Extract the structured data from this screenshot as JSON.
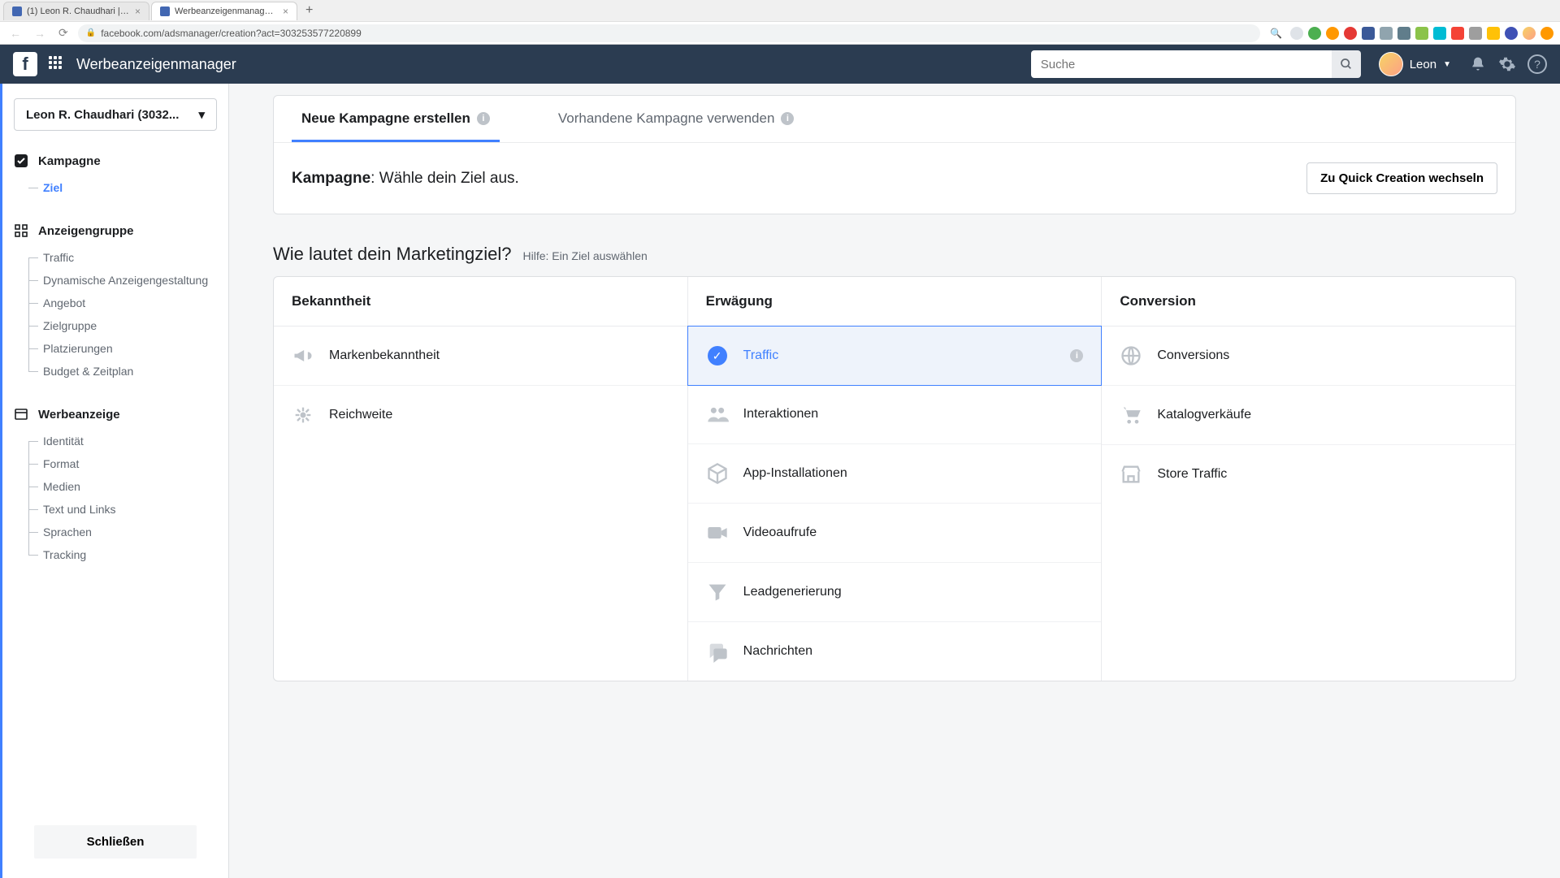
{
  "browser": {
    "tabs": [
      {
        "title": "(1) Leon R. Chaudhari | Faceb"
      },
      {
        "title": "Werbeanzeigenmanager - Cre"
      }
    ],
    "url": "facebook.com/adsmanager/creation?act=303253577220899"
  },
  "navbar": {
    "app_title": "Werbeanzeigenmanager",
    "search_placeholder": "Suche",
    "user_name": "Leon"
  },
  "sidebar": {
    "account_label": "Leon R. Chaudhari (3032...",
    "sections": {
      "campaign": {
        "title": "Kampagne",
        "items": [
          "Ziel"
        ]
      },
      "adgroup": {
        "title": "Anzeigengruppe",
        "items": [
          "Traffic",
          "Dynamische Anzeigengestaltung",
          "Angebot",
          "Zielgruppe",
          "Platzierungen",
          "Budget & Zeitplan"
        ]
      },
      "ad": {
        "title": "Werbeanzeige",
        "items": [
          "Identität",
          "Format",
          "Medien",
          "Text und Links",
          "Sprachen",
          "Tracking"
        ]
      }
    },
    "close_label": "Schließen"
  },
  "main": {
    "tab_new": "Neue Kampagne erstellen",
    "tab_existing": "Vorhandene Kampagne verwenden",
    "objective_strong": "Kampagne",
    "objective_rest": ": Wähle dein Ziel aus.",
    "quick_switch": "Zu Quick Creation wechseln",
    "question": "Wie lautet dein Marketingziel?",
    "help_link": "Hilfe: Ein Ziel auswählen",
    "columns": {
      "awareness": {
        "title": "Bekanntheit",
        "items": [
          "Markenbekanntheit",
          "Reichweite"
        ]
      },
      "consideration": {
        "title": "Erwägung",
        "items": [
          "Traffic",
          "Interaktionen",
          "App-Installationen",
          "Videoaufrufe",
          "Leadgenerierung",
          "Nachrichten"
        ]
      },
      "conversion": {
        "title": "Conversion",
        "items": [
          "Conversions",
          "Katalogverkäufe",
          "Store Traffic"
        ]
      }
    }
  }
}
